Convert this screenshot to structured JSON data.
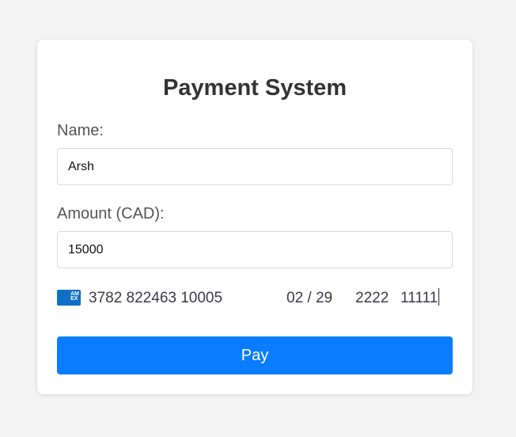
{
  "form": {
    "title": "Payment System",
    "name_label": "Name:",
    "name_value": "Arsh",
    "amount_label": "Amount (CAD):",
    "amount_value": "15000",
    "card": {
      "brand_icon": "amex-card-icon",
      "brand_text": "AMEX",
      "number": "3782 822463 10005",
      "expiry": "02 / 29",
      "cvc": "2222",
      "postal": "11111"
    },
    "pay_label": "Pay"
  },
  "colors": {
    "page_bg": "#f3f3f3",
    "card_bg": "#ffffff",
    "accent": "#0a7cff",
    "amex_blue": "#0f6fc6"
  }
}
